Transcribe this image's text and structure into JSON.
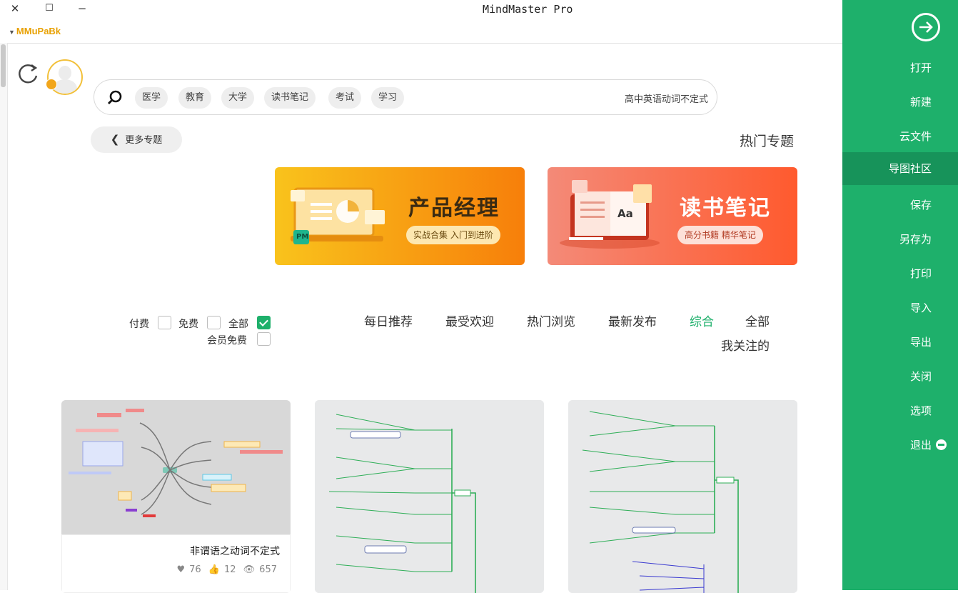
{
  "window": {
    "title": "MindMaster Pro",
    "close_glyph": "✕",
    "maximize_glyph": "☐",
    "minimize_glyph": "−",
    "account_name": "MMuPaBk"
  },
  "search": {
    "value": "高中英语动词不定式",
    "tags": [
      "学习",
      "考试",
      "读书笔记",
      "大学",
      "教育",
      "医学"
    ]
  },
  "hot": {
    "title": "热门专题",
    "more_label": "更多专题",
    "banners": [
      {
        "title": "读书笔记",
        "subtitle": "高分书籍 精华笔记",
        "badge": "Aa"
      },
      {
        "title": "产品经理",
        "subtitle": "实战合集 入门到进阶",
        "badge": "PM"
      }
    ]
  },
  "tabs": [
    "全部",
    "综合",
    "最新发布",
    "热门浏览",
    "最受欢迎",
    "每日推荐",
    "我关注的"
  ],
  "active_tab": "综合",
  "filters": {
    "all": "全部",
    "free": "免费",
    "paid": "付费",
    "member_free": "会员免费"
  },
  "sidebar": {
    "items": [
      "打开",
      "新建",
      "云文件",
      "导图社区",
      "保存",
      "另存为",
      "打印",
      "导入",
      "导出",
      "关闭",
      "选项",
      "退出"
    ],
    "active": "导图社区"
  },
  "cards": [
    {
      "title": "非谓语之动词不定式",
      "views": "657",
      "likes": "12",
      "favorites": "76"
    }
  ],
  "colors": {
    "accent": "#1eb06b",
    "sidebar_active": "#17935a",
    "account": "#e8a000"
  }
}
